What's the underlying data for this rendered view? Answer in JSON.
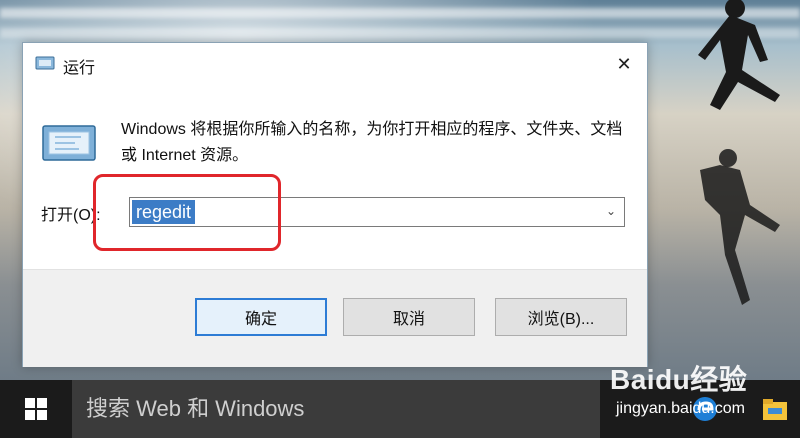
{
  "dialog": {
    "title": "运行",
    "close_glyph": "✕",
    "description": "Windows 将根据你所输入的名称，为你打开相应的程序、文件夹、文档或 Internet 资源。",
    "open_label": "打开(O):",
    "input_value": "regedit",
    "dropdown_glyph": "⌄",
    "buttons": {
      "ok": "确定",
      "cancel": "取消",
      "browse": "浏览(B)..."
    }
  },
  "taskbar": {
    "search_placeholder": "搜索 Web 和 Windows"
  },
  "watermark": {
    "logo_text": "Baidu经验",
    "url": "jingyan.baidu.com"
  },
  "colors": {
    "selection": "#3c7cc6",
    "highlight_box": "#e0262b",
    "primary_button_border": "#2d7cd5",
    "taskbar": "#1b1b1b"
  },
  "icons": {
    "title": "run-icon",
    "content": "run-icon",
    "start": "windows-logo-icon",
    "edge": "edge-icon",
    "explorer": "file-explorer-icon"
  }
}
